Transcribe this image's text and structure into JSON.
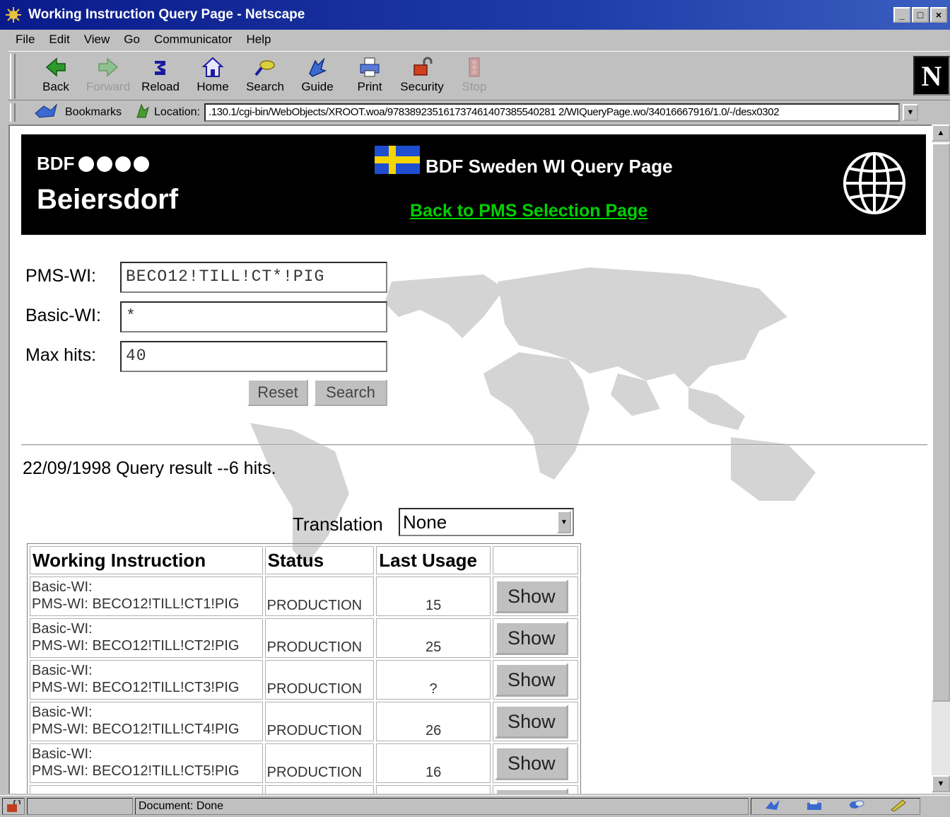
{
  "window": {
    "title": "Working Instruction Query Page - Netscape",
    "controls": [
      "_",
      "□",
      "×"
    ]
  },
  "menu": {
    "items": [
      "File",
      "Edit",
      "View",
      "Go",
      "Communicator",
      "Help"
    ]
  },
  "toolbar": {
    "buttons": [
      {
        "label": "Back",
        "icon": "back-arrow-icon",
        "enabled": true
      },
      {
        "label": "Forward",
        "icon": "forward-arrow-icon",
        "enabled": false
      },
      {
        "label": "Reload",
        "icon": "reload-icon",
        "enabled": true
      },
      {
        "label": "Home",
        "icon": "home-icon",
        "enabled": true
      },
      {
        "label": "Search",
        "icon": "search-icon",
        "enabled": true
      },
      {
        "label": "Guide",
        "icon": "guide-icon",
        "enabled": true
      },
      {
        "label": "Print",
        "icon": "print-icon",
        "enabled": true
      },
      {
        "label": "Security",
        "icon": "lock-icon",
        "enabled": true
      },
      {
        "label": "Stop",
        "icon": "stop-icon",
        "enabled": false
      }
    ],
    "logo": "N"
  },
  "location": {
    "bookmarks_label": "Bookmarks",
    "location_label": "Location:",
    "url": ".130.1/cgi-bin/WebObjects/XROOT.woa/978389235161737461407385540281 2/WIQueryPage.wo/34016667916/1.0/-/desx0302"
  },
  "banner": {
    "bdf": "BDF",
    "company": "Beiersdorf",
    "title": "BDF Sweden WI Query Page",
    "back_link": "Back to PMS Selection Page "
  },
  "form": {
    "pms_label": "PMS-WI:",
    "pms_value": "BECO12!TILL!CT*!PIG",
    "basic_label": "Basic-WI:",
    "basic_value": "*",
    "max_label": "Max hits:",
    "max_value": "40",
    "reset_label": "Reset",
    "search_label": "Search"
  },
  "result": {
    "summary": "22/09/1998 Query result --6 hits.",
    "translation_label": "Translation",
    "translation_value": "None"
  },
  "table": {
    "headers": [
      "Working Instruction",
      "Status",
      "Last Usage",
      ""
    ],
    "rows": [
      {
        "basic": "Basic-WI:",
        "pms": "PMS-WI: BECO12!TILL!CT1!PIG",
        "status": "PRODUCTION",
        "usage": "15",
        "action": "Show"
      },
      {
        "basic": "Basic-WI:",
        "pms": "PMS-WI: BECO12!TILL!CT2!PIG",
        "status": "PRODUCTION",
        "usage": "25",
        "action": "Show"
      },
      {
        "basic": "Basic-WI:",
        "pms": "PMS-WI: BECO12!TILL!CT3!PIG",
        "status": "PRODUCTION",
        "usage": "?",
        "action": "Show"
      },
      {
        "basic": "Basic-WI:",
        "pms": "PMS-WI: BECO12!TILL!CT4!PIG",
        "status": "PRODUCTION",
        "usage": "26",
        "action": "Show"
      },
      {
        "basic": "Basic-WI:",
        "pms": "PMS-WI: BECO12!TILL!CT5!PIG",
        "status": "PRODUCTION",
        "usage": "16",
        "action": "Show"
      }
    ]
  },
  "status": {
    "text": "Document: Done"
  },
  "colors": {
    "titlebar": "#0a1a8a",
    "link": "#00d000",
    "flag_blue": "#1f4fd0",
    "flag_yellow": "#f6d400"
  }
}
